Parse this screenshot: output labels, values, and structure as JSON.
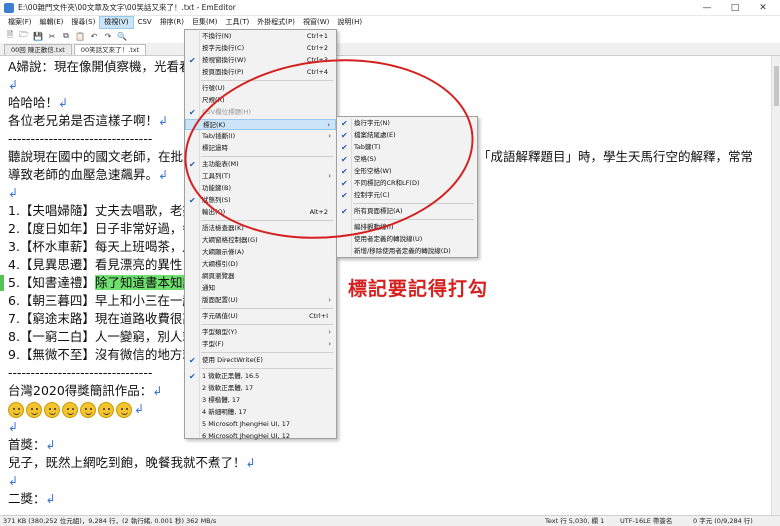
{
  "window": {
    "title": "E:\\00雜門文件夾\\00文章及文字\\00笑話又來了！.txt - EmEditor"
  },
  "menubar": [
    "檔案(F)",
    "編輯(E)",
    "搜尋(S)",
    "檢視(V)",
    "CSV",
    "排序(R)",
    "巨集(M)",
    "工具(T)",
    "外掛程式(P)",
    "視窗(W)",
    "說明(H)"
  ],
  "tabs": [
    "00回 陳正歡信.txt",
    "00笑話又來了！.txt"
  ],
  "editor_lines": {
    "l1": "A婦說：現在像開偵察機，光看看",
    "l3": "哈哈哈！",
    "l4": "各位老兄弟是否這樣子啊！",
    "l5": "--------------------------------",
    "l6a": "聽說現在國中的國文老師，在批改",
    "l6b": "「成語解釋題目」時，學生天馬行空的解釋，常常",
    "l7": "導致老師的血壓急速飆昇。",
    "l9": "1.【夫唱婦隨】丈夫去唱歌，老婆",
    "l10": "2.【度日如年】日子非常好過，每",
    "l11": "3.【杯水車薪】每天上班喝茶，月",
    "l12": "4.【見異思遷】看見漂亮的異性，",
    "l13a": "5.【知書達禮】",
    "l13b": "除了知道書本知識",
    "l14": "6.【朝三暮四】早上和小三在一起",
    "l15": "7.【窮途末路】現在道路收費很高",
    "l16": "8.【一窮二白】人一變窮，別人就",
    "l17": "9.【無微不至】沒有微信的地方就",
    "l18": "--------------------------------",
    "l19": "台灣2020得獎簡訊作品：",
    "l22": "首獎：",
    "l23": "兒子，既然上網吃到飽，晚餐我就不煮了！",
    "l25": "二獎："
  },
  "return_mark": "↲",
  "view_menu": {
    "items": [
      {
        "label": "不換行(N)",
        "shortcut": "Ctrl+1",
        "checked": false
      },
      {
        "label": "按字元換行(C)",
        "shortcut": "Ctrl+2",
        "checked": false
      },
      {
        "label": "按視窗換行(W)",
        "shortcut": "Ctrl+3",
        "checked": true
      },
      {
        "label": "按頁面換行(P)",
        "shortcut": "Ctrl+4",
        "checked": false
      },
      {
        "label": "行號(U)",
        "shortcut": "",
        "checked": false
      },
      {
        "label": "尺規(R)",
        "shortcut": "",
        "checked": false
      },
      {
        "label": "CSV欄位標題(H)",
        "shortcut": "",
        "checked": true,
        "disabled": true
      },
      {
        "label": "標記(K)",
        "shortcut": "",
        "checked": false,
        "submenu": true
      },
      {
        "label": "Tab/插斷(I)",
        "shortcut": "",
        "checked": false,
        "submenu": true
      },
      {
        "label": "標記過時",
        "shortcut": "",
        "checked": false
      },
      {
        "label": "主功能表(M)",
        "shortcut": "",
        "checked": true
      },
      {
        "label": "工具列(T)",
        "shortcut": "",
        "checked": false,
        "submenu": true
      },
      {
        "label": "功能鍵(B)",
        "shortcut": "",
        "checked": false
      },
      {
        "label": "狀態列(S)",
        "shortcut": "",
        "checked": true
      },
      {
        "label": "輸出(O)",
        "shortcut": "Alt+2",
        "checked": false
      },
      {
        "label": "語法檢查器(K)",
        "shortcut": "",
        "checked": false
      },
      {
        "label": "大綱窗格控制器(G)",
        "shortcut": "",
        "checked": false
      },
      {
        "label": "大綱顯示條(A)",
        "shortcut": "",
        "checked": false
      },
      {
        "label": "大綱標引(D)",
        "shortcut": "",
        "checked": false
      },
      {
        "label": "網頁瀏覽器",
        "shortcut": "",
        "checked": false
      },
      {
        "label": "通知",
        "shortcut": "",
        "checked": false
      },
      {
        "label": "版面配置(U)",
        "shortcut": "",
        "checked": false,
        "submenu": true
      },
      {
        "label": "字元碼值(U)",
        "shortcut": "Ctrl+I",
        "checked": false
      },
      {
        "label": "字型類型(Y)",
        "shortcut": "",
        "checked": false,
        "submenu": true
      },
      {
        "label": "字型(F)",
        "shortcut": "",
        "checked": false,
        "submenu": true
      },
      {
        "label": "使用 DirectWrite(E)",
        "shortcut": "",
        "checked": true
      },
      {
        "label": "1 微軟正黑體, 16.5",
        "shortcut": "",
        "checked": true
      },
      {
        "label": "2 微軟正黑體, 17",
        "shortcut": "",
        "checked": false
      },
      {
        "label": "3 標楷體, 17",
        "shortcut": "",
        "checked": false
      },
      {
        "label": "4 新細明體, 17",
        "shortcut": "",
        "checked": false
      },
      {
        "label": "5 Microsoft JhengHei UI, 17",
        "shortcut": "",
        "checked": false
      },
      {
        "label": "6 Microsoft JhengHei UI, 12",
        "shortcut": "",
        "checked": false
      }
    ]
  },
  "marks_submenu": {
    "items": [
      {
        "label": "換行字元(N)",
        "checked": true
      },
      {
        "label": "檔案結尾處(E)",
        "checked": true
      },
      {
        "label": "Tab鍵(T)",
        "checked": true
      },
      {
        "label": "空格(S)",
        "checked": true
      },
      {
        "label": "全形空格(W)",
        "checked": true
      },
      {
        "label": "不同標記的CR和LF(D)",
        "checked": true
      },
      {
        "label": "控制字元(C)",
        "checked": true
      },
      {
        "label": "所有頁面標記(A)",
        "checked": true
      },
      {
        "label": "編排觀動線(I)",
        "checked": false
      },
      {
        "label": "使用者定義的轉說線(U)",
        "checked": false
      },
      {
        "label": "新增/移除使用者定義的轉說線(D)",
        "checked": false
      }
    ]
  },
  "statusbar": {
    "left": "371 KB (380,252 位元組)，9,284 行，(2 執行緒, 0.001 秒) 362 MB/s",
    "pos": "Text  行 5,030, 欄 1",
    "encoding": "UTF-16LE 帶簽名",
    "count": "0 字元 (0/9,284 行)"
  },
  "annotation": "標記要記得打勾",
  "colors": {
    "accent": "#d62020",
    "highlight": "#6de06d",
    "return_mark": "#3a73d6"
  }
}
